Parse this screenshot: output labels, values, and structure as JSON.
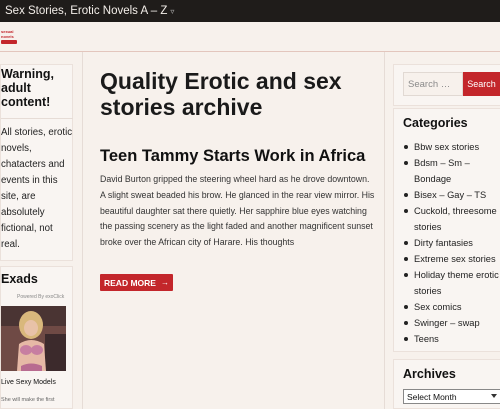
{
  "topbar": {
    "site_menu": "Sex Stories, Erotic Novels A – Z",
    "caret": "▿"
  },
  "logo": {
    "text": "sexual novels"
  },
  "left": {
    "warning_title": "Warning, adult content!",
    "warning_text": "All  stories, erotic novels, chatacters and events in this site, are absolutely fictional, not real.",
    "exads_title": "Exads",
    "powered_by": "Powered By exoClick",
    "live_models": "Live Sexy Models",
    "she_will": "She will make the first"
  },
  "main": {
    "page_title": "Quality Erotic and sex stories archive",
    "post_title": "Teen Tammy Starts Work in Africa",
    "excerpt": "David Burton gripped the steering wheel hard as he drove downtown. A slight sweat beaded his brow. He glanced in the rear view mirror. His beautiful daughter sat there quietly. Her sapphire blue eyes watching the passing scenery as the light faded and another magnificent sunset broke over the African city of Harare. His thoughts",
    "read_more": "READ MORE",
    "read_more_arrow": "→"
  },
  "sidebar": {
    "search_placeholder": "Search …",
    "search_button": "Search",
    "categories_title": "Categories",
    "categories": [
      "Bbw sex stories",
      "Bdsm – Sm – Bondage",
      "Bisex – Gay – TS",
      "Cuckold, threesome stories",
      "Dirty fantasies",
      "Extreme sex stories",
      "Holiday theme erotic stories",
      "Sex comics",
      "Swinger – swap",
      "Teens"
    ],
    "archives_title": "Archives",
    "archives_select": "Select Month"
  },
  "colors": {
    "accent": "#c3262b",
    "topbar": "#1f1c1a",
    "background": "#f7f1ec"
  },
  "icons": {
    "logo": "site-logo-icon",
    "dropdown": "chevron-down-icon",
    "arrow": "arrow-right-icon"
  }
}
